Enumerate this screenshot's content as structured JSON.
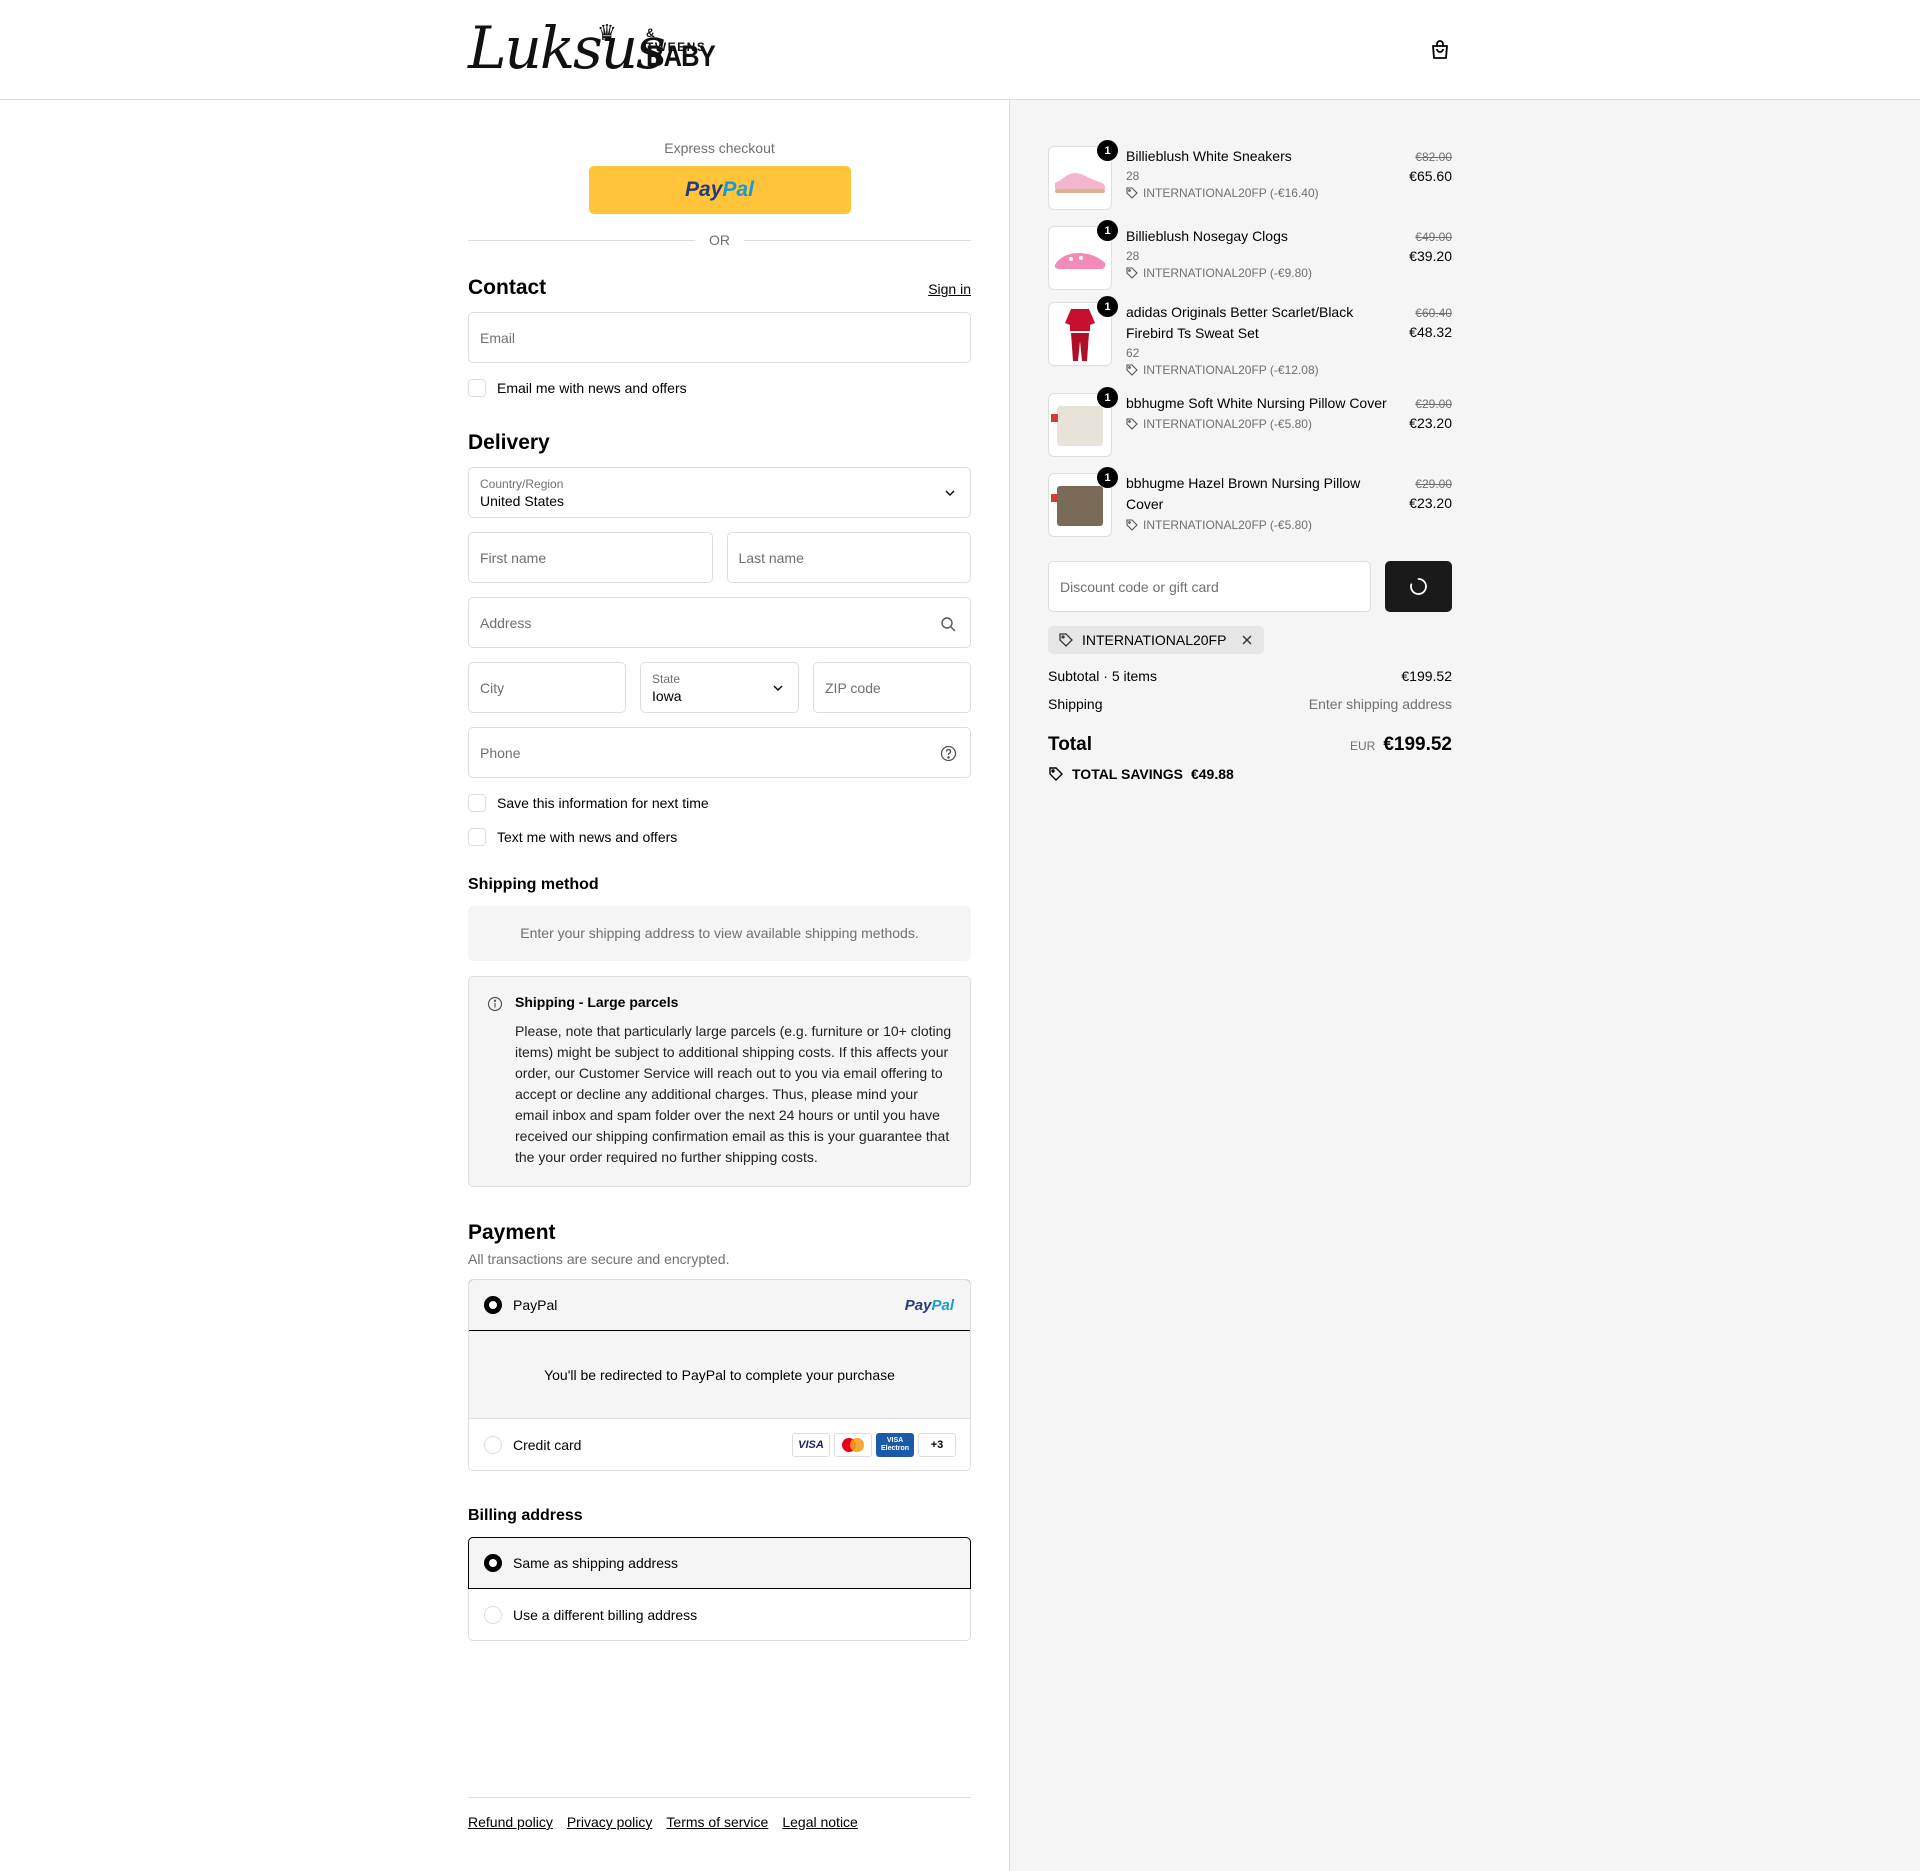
{
  "brand": {
    "script": "Luksus",
    "tweens": "& TWEENS",
    "baby": "BABY"
  },
  "express": {
    "label": "Express checkout",
    "or": "OR"
  },
  "contact": {
    "title": "Contact",
    "sign_in": "Sign in",
    "email_placeholder": "Email",
    "news_label": "Email me with news and offers"
  },
  "delivery": {
    "title": "Delivery",
    "country_label": "Country/Region",
    "country_value": "United States",
    "first_name": "First name",
    "last_name": "Last name",
    "address": "Address",
    "city": "City",
    "state_label": "State",
    "state_value": "Iowa",
    "zip": "ZIP code",
    "phone": "Phone",
    "save_info": "Save this information for next time",
    "text_news": "Text me with news and offers"
  },
  "shipping": {
    "title": "Shipping method",
    "empty": "Enter your shipping address to view available shipping methods.",
    "notice_title": "Shipping - Large parcels",
    "notice_body": "Please, note that particularly large parcels (e.g. furniture or 10+ cloting items) might be subject to additional shipping costs. If this affects your order, our Customer Service will reach out to you via email offering to accept or decline any additional charges. Thus, please mind your email inbox and spam folder over the next 24 hours or until you have received our shipping confirmation email as this is your guarantee that the your order required no further shipping costs."
  },
  "payment": {
    "title": "Payment",
    "subtitle": "All transactions are secure and encrypted.",
    "paypal_label": "PayPal",
    "redirect": "You'll be redirected to PayPal to complete your purchase",
    "credit_label": "Credit card",
    "cards": {
      "visa": "VISA",
      "electron_top": "VISA",
      "electron_bottom": "Electron",
      "more": "+3"
    }
  },
  "billing": {
    "title": "Billing address",
    "same": "Same as shipping address",
    "different": "Use a different billing address"
  },
  "footer": {
    "refund": "Refund policy",
    "privacy": "Privacy policy",
    "terms": "Terms of service",
    "legal": "Legal notice"
  },
  "cart": {
    "items": [
      {
        "name": "Billieblush White Sneakers",
        "variant": "28",
        "discount": "INTERNATIONAL20FP (-€16.40)",
        "old_price": "€82.00",
        "price": "€65.60",
        "qty": "1",
        "color": "#f4b6cf"
      },
      {
        "name": "Billieblush Nosegay Clogs",
        "variant": "28",
        "discount": "INTERNATIONAL20FP (-€9.80)",
        "old_price": "€49.00",
        "price": "€39.20",
        "qty": "1",
        "color": "#f28bb7"
      },
      {
        "name": "adidas Originals Better Scarlet/Black Firebird Ts Sweat Set",
        "variant": "62",
        "discount": "INTERNATIONAL20FP (-€12.08)",
        "old_price": "€60.40",
        "price": "€48.32",
        "qty": "1",
        "color": "#c8102e"
      },
      {
        "name": "bbhugme Soft White Nursing Pillow Cover",
        "variant": "",
        "discount": "INTERNATIONAL20FP (-€5.80)",
        "old_price": "€29.00",
        "price": "€23.20",
        "qty": "1",
        "color": "#e8e3d8"
      },
      {
        "name": "bbhugme Hazel Brown Nursing Pillow Cover",
        "variant": "",
        "discount": "INTERNATIONAL20FP (-€5.80)",
        "old_price": "€29.00",
        "price": "€23.20",
        "qty": "1",
        "color": "#7a6a58"
      }
    ],
    "discount_placeholder": "Discount code or gift card",
    "applied_code": "INTERNATIONAL20FP",
    "subtotal_label": "Subtotal · 5 items",
    "subtotal": "€199.52",
    "shipping_label": "Shipping",
    "shipping_value": "Enter shipping address",
    "total_label": "Total",
    "currency": "EUR",
    "total": "€199.52",
    "savings_label": "TOTAL SAVINGS",
    "savings": "€49.88"
  }
}
